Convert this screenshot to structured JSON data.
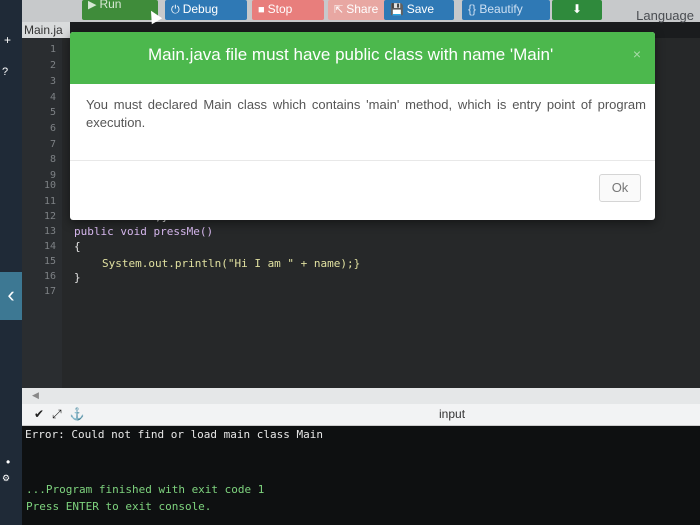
{
  "toolbar": {
    "run_label": "Run",
    "debug_label": "Debug",
    "stop_label": "Stop",
    "share_label": "Share",
    "save_label": "Save",
    "beautify_label": "{} Beautify",
    "language_label": "Language"
  },
  "file_tab": {
    "label": "Main.ja"
  },
  "editor": {
    "line_numbers": [
      "1",
      "2",
      "3",
      "4",
      "5",
      "6",
      "7",
      "8",
      "9",
      "10",
      "11",
      "12",
      "13",
      "14",
      "15",
      "16",
      "17"
    ],
    "visible_code": [
      "name = n;}",
      "public void pressMe()",
      "{",
      "System.out.println(\"Hi I am \" + name);}",
      "}"
    ]
  },
  "modal": {
    "title": "Main.java file must have public class with name 'Main'",
    "body": "You must declared Main class which contains 'main' method, which is entry point of program execution.",
    "ok_label": "Ok",
    "close_label": "×",
    "header_color": "#4cb84d"
  },
  "console": {
    "input_label": "input",
    "error_line": "Error: Could not find or load main class Main",
    "finished_line": "...Program finished with exit code 1",
    "press_line": "Press ENTER to exit console."
  }
}
